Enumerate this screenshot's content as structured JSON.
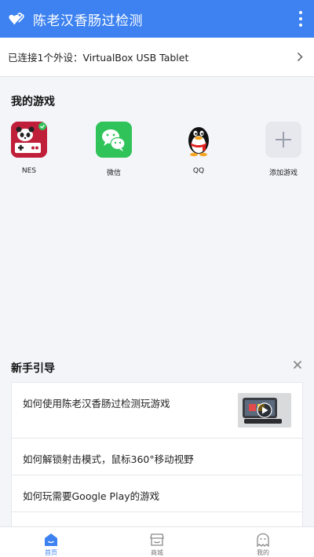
{
  "app": {
    "title": "陈老汉香肠过检测"
  },
  "device": {
    "status": "已连接1个外设：VirtualBox USB Tablet"
  },
  "my_games": {
    "title": "我的游戏",
    "items": [
      {
        "label": "NES"
      },
      {
        "label": "微信"
      },
      {
        "label": "QQ"
      },
      {
        "label": "添加游戏"
      }
    ]
  },
  "guide": {
    "title": "新手引导",
    "items": [
      {
        "text": "如何使用陈老汉香肠过检测玩游戏"
      },
      {
        "text": "如何解锁射击模式，鼠标360°移动视野"
      },
      {
        "text": "如何玩需要Google Play的游戏"
      }
    ]
  },
  "tabs": [
    {
      "label": "首页",
      "active": true
    },
    {
      "label": "商城",
      "active": false
    },
    {
      "label": "我的",
      "active": false
    }
  ],
  "colors": {
    "primary": "#3d82f0",
    "background": "#f4f5f9"
  }
}
